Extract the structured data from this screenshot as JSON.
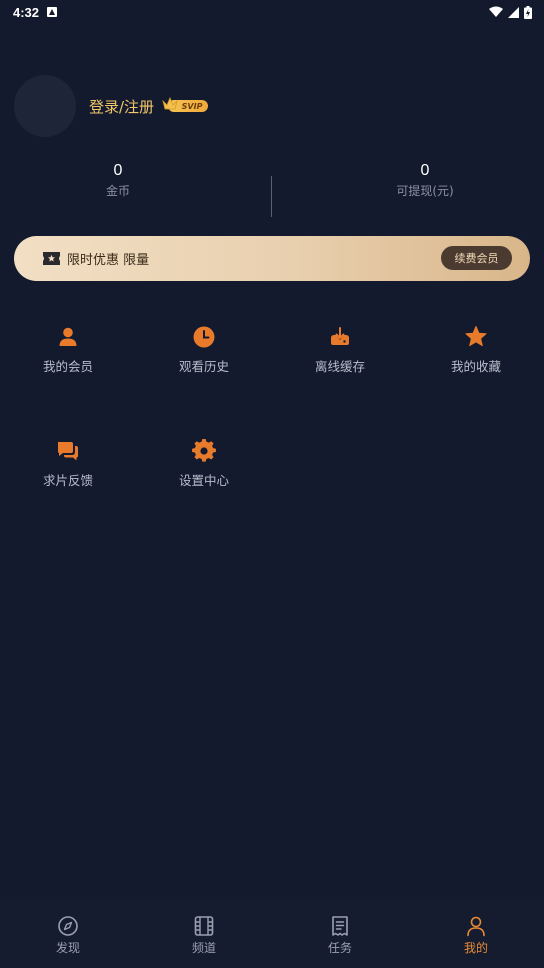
{
  "status_bar": {
    "time": "4:32"
  },
  "profile": {
    "login_label": "登录/注册",
    "badge": "SVIP"
  },
  "stats": {
    "gold": {
      "value": "0",
      "label": "金币"
    },
    "cash": {
      "value": "0",
      "label": "可提现(元)"
    }
  },
  "promo": {
    "text": "限时优惠 限量",
    "button": "续费会员"
  },
  "grid": [
    {
      "label": "我的会员",
      "icon": "person-icon"
    },
    {
      "label": "观看历史",
      "icon": "clock-icon"
    },
    {
      "label": "离线缓存",
      "icon": "download-icon"
    },
    {
      "label": "我的收藏",
      "icon": "star-icon"
    },
    {
      "label": "求片反馈",
      "icon": "chat-icon"
    },
    {
      "label": "设置中心",
      "icon": "gear-icon"
    }
  ],
  "bottom_nav": [
    {
      "label": "发现",
      "icon": "compass-icon",
      "active": false
    },
    {
      "label": "频道",
      "icon": "film-icon",
      "active": false
    },
    {
      "label": "任务",
      "icon": "task-icon",
      "active": false
    },
    {
      "label": "我的",
      "icon": "user-icon",
      "active": true
    }
  ],
  "colors": {
    "accent": "#e88a35",
    "background": "#141a2e",
    "gold_text": "#f2c66b"
  }
}
